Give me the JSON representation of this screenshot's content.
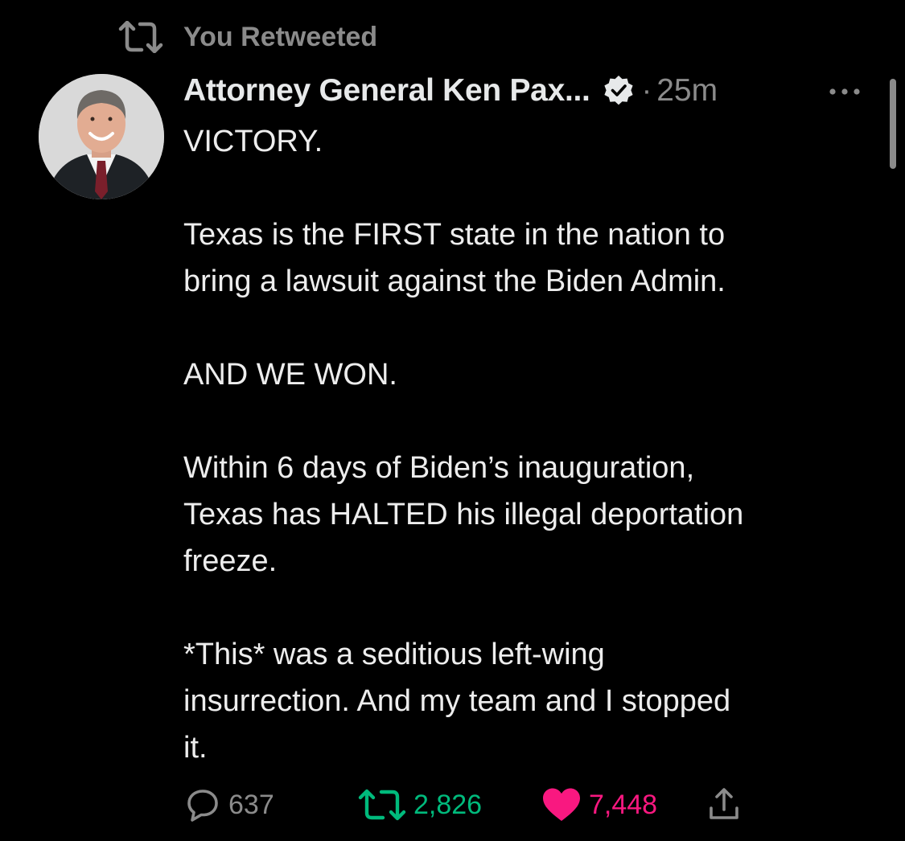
{
  "social_context": {
    "text": "You Retweeted",
    "icon": "retweet-icon"
  },
  "tweet": {
    "author_name": "Attorney General Ken Pax...",
    "verified_icon": "verified-badge-icon",
    "separator": "·",
    "timestamp": "25m",
    "more_icon": "more-options-icon",
    "lines": [
      "VICTORY.",
      "",
      "Texas is the FIRST state in the nation to",
      "bring a lawsuit against the Biden Admin.",
      "",
      "AND WE WON.",
      "",
      "Within 6 days of Biden’s inauguration,",
      "Texas has HALTED his illegal deportation",
      "freeze.",
      "",
      "*This* was a seditious left-wing",
      "insurrection. And my team and I stopped",
      "it."
    ]
  },
  "actions": {
    "reply": {
      "icon": "reply-icon",
      "count": "637"
    },
    "retweet": {
      "icon": "retweet-icon",
      "count": "2,826",
      "active": true
    },
    "like": {
      "icon": "heart-icon",
      "count": "7,448",
      "active": true
    },
    "share": {
      "icon": "share-icon"
    }
  },
  "colors": {
    "background": "#000000",
    "text": "#e7e9ea",
    "secondary": "#8b8b8b",
    "retweet_active": "#00ba7c",
    "like_active": "#f91880"
  }
}
